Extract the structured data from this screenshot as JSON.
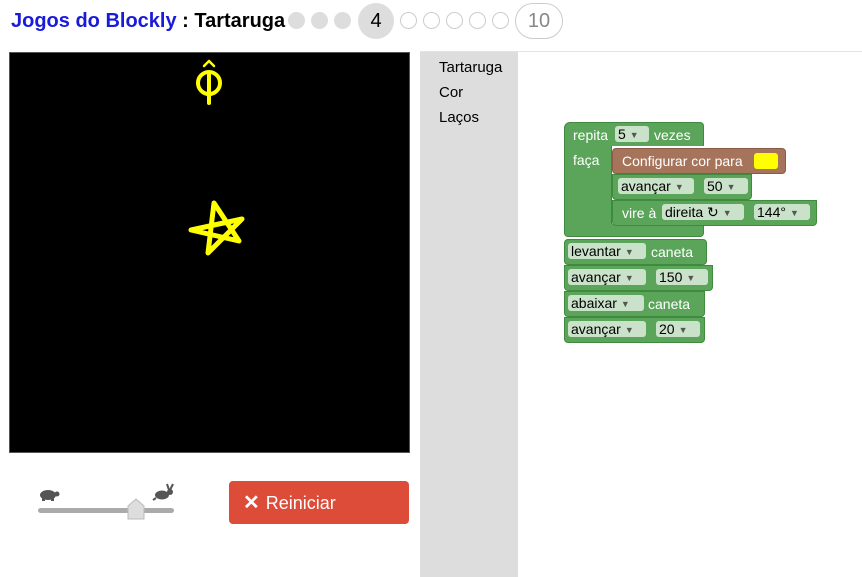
{
  "header": {
    "app_name": "Jogos do Blockly",
    "separator": " : ",
    "game_name": "Tartaruga",
    "current_level": "4",
    "last_level": "10"
  },
  "controls": {
    "reset_label": "Reiniciar",
    "reset_icon": "close-icon",
    "speed_slow_icon": "turtle-icon",
    "speed_fast_icon": "rabbit-icon",
    "speed_level": 0.72
  },
  "toolbox": {
    "categories": [
      "Tartaruga",
      "Cor",
      "Laços"
    ]
  },
  "blocks": {
    "repeat": {
      "prefix": "repita",
      "count": "5",
      "suffix": "vezes",
      "do": "faça"
    },
    "set_color": {
      "label": "Configurar cor para",
      "color": "#ffff00"
    },
    "move1": {
      "dir": "avançar",
      "dist": "50"
    },
    "turn": {
      "prefix": "vire à",
      "dir": "direita ↻",
      "angle": "144°"
    },
    "pen_up": {
      "mode": "levantar",
      "suffix": "caneta"
    },
    "move2": {
      "dir": "avançar",
      "dist": "150"
    },
    "pen_down": {
      "mode": "abaixar",
      "suffix": "caneta"
    },
    "move3": {
      "dir": "avançar",
      "dist": "20"
    }
  },
  "colors": {
    "accent_link": "#1a1adb",
    "reset_button": "#dd4b39",
    "turtle_block": "#5ba55b",
    "color_block": "#a5745b",
    "drawing": "#ffff00"
  }
}
